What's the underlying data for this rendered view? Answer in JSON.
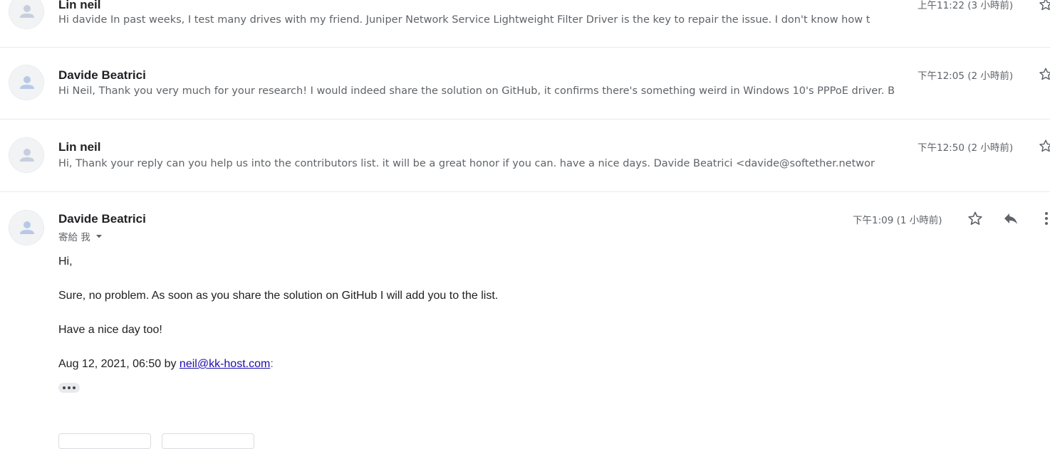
{
  "messages": [
    {
      "sender": "Lin neil",
      "snippet": "Hi davide In past weeks, I test many drives with my friend. Juniper Network Service Lightweight Filter Driver is the key to repair the issue. I don't know how t",
      "time": "上午11:22 (3 小時前)"
    },
    {
      "sender": "Davide Beatrici",
      "snippet": "Hi Neil, Thank you very much for your research! I would indeed share the solution on GitHub, it confirms there's something weird in Windows 10's PPPoE driver. B",
      "time": "下午12:05 (2 小時前)"
    },
    {
      "sender": "Lin neil",
      "snippet": "Hi, Thank your reply can you help us into the contributors list. it will be a great honor if you can. have a nice days. Davide Beatrici <davide@softether.networ",
      "time": "下午12:50 (2 小時前)"
    }
  ],
  "expanded": {
    "sender": "Davide Beatrici",
    "recipient": "寄給 我",
    "time": "下午1:09 (1 小時前)",
    "body": {
      "greeting": "Hi,",
      "line1": "Sure, no problem. As soon as you share the solution on GitHub I will add you to the list.",
      "line2": "Have a nice day too!",
      "quote_prefix": "Aug 12, 2021, 06:50 by ",
      "quote_email": "neil@kk-host.com",
      "quote_suffix": ":"
    }
  },
  "icons": {
    "avatar": "default-avatar-icon",
    "star": "star-icon",
    "reply": "reply-icon",
    "more": "more-vert-icon",
    "dropdown": "caret-down-icon",
    "ellipsis": "show-trimmed-content-icon"
  },
  "colors": {
    "avatar_bg": "#f1f3f4",
    "avatar_fg": "#c5cfde",
    "link": "#1a0dab",
    "muted": "#5f6368"
  }
}
